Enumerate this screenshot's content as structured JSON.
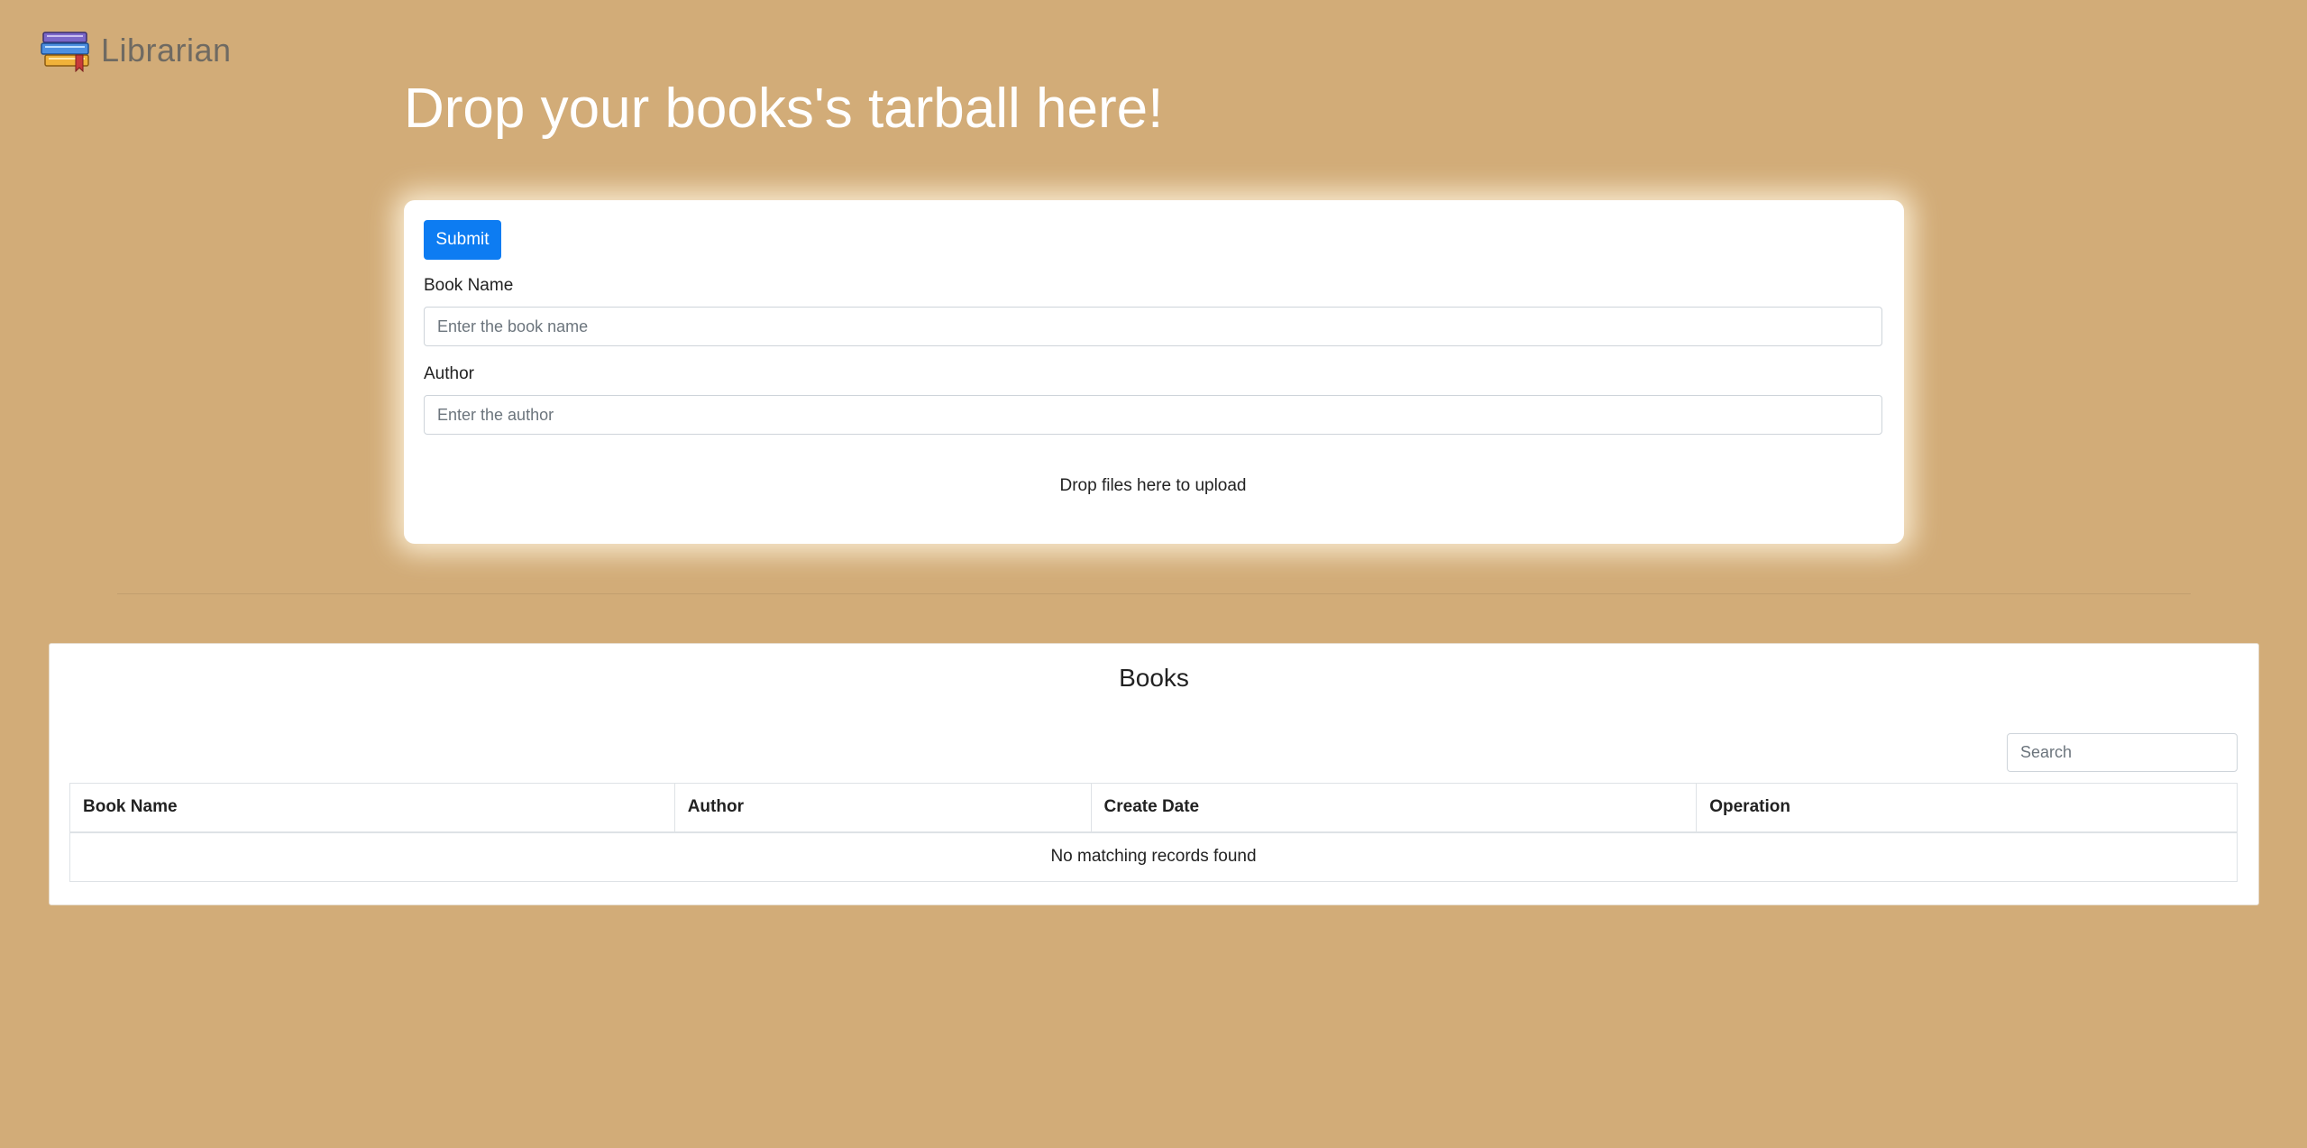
{
  "brand": {
    "name": "Librarian",
    "logo_icon": "books-stack-icon"
  },
  "page": {
    "title": "Drop your books's tarball here!"
  },
  "upload_form": {
    "submit_label": "Submit",
    "book_name_label": "Book Name",
    "book_name_placeholder": "Enter the book name",
    "book_name_value": "",
    "author_label": "Author",
    "author_placeholder": "Enter the author",
    "author_value": "",
    "dropzone_text": "Drop files here to upload"
  },
  "books": {
    "title": "Books",
    "search_placeholder": "Search",
    "columns": [
      "Book Name",
      "Author",
      "Create Date",
      "Operation"
    ],
    "rows": [],
    "empty_message": "No matching records found"
  },
  "colors": {
    "background": "#d2ac78",
    "primary": "#0d7cf2",
    "title_text": "#ffffff",
    "brand_text": "#6f6a62"
  }
}
